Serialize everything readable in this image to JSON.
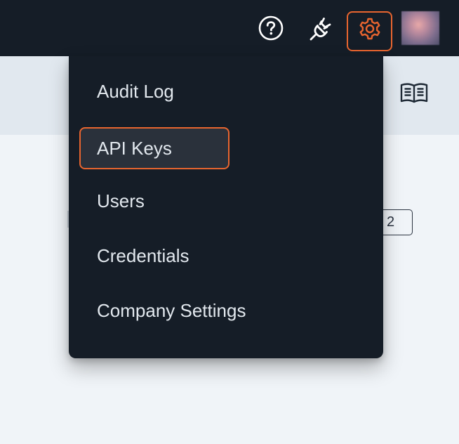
{
  "topbar": {
    "icons": {
      "help": "help-circle-icon",
      "integrations": "plug-icon",
      "settings": "gear-icon",
      "avatar": "user-avatar"
    }
  },
  "subheader": {
    "icon": "book-open-icon"
  },
  "dropdown": {
    "items": [
      {
        "label": "Audit Log",
        "active": false
      },
      {
        "label": "API Keys",
        "active": true
      },
      {
        "label": "Users",
        "active": false
      },
      {
        "label": "Credentials",
        "active": false
      },
      {
        "label": "Company Settings",
        "active": false
      }
    ]
  },
  "pagination": {
    "visible_page": "2"
  },
  "colors": {
    "topbar_bg": "#151d27",
    "highlight": "#e8652f",
    "menu_active_bg": "#2a313b",
    "menu_text": "#e2e8ee"
  }
}
